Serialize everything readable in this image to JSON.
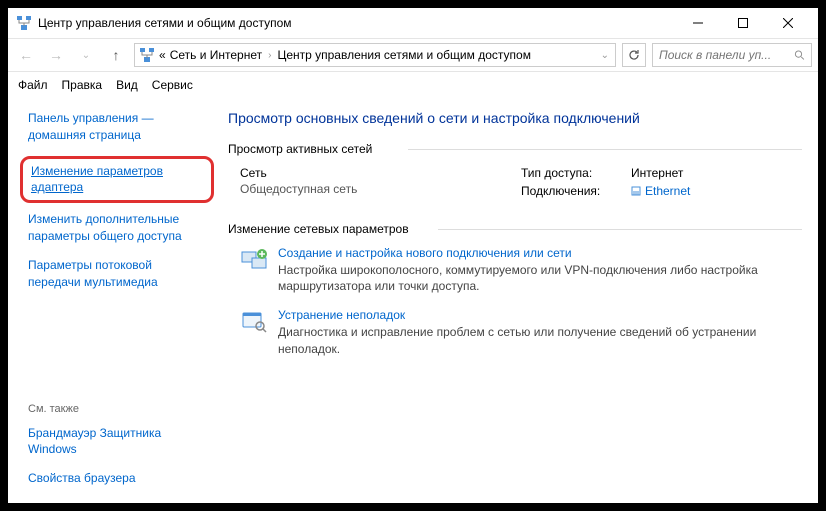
{
  "window": {
    "title": "Центр управления сетями и общим доступом"
  },
  "addressbar": {
    "prefix": "«",
    "seg1": "Сеть и Интернет",
    "seg2": "Центр управления сетями и общим доступом"
  },
  "search": {
    "placeholder": "Поиск в панели уп..."
  },
  "menu": {
    "file": "Файл",
    "edit": "Правка",
    "view": "Вид",
    "tools": "Сервис"
  },
  "sidebar": {
    "home": "Панель управления — домашняя страница",
    "adapter": "Изменение параметров адаптера",
    "sharing": "Изменить дополнительные параметры общего доступа",
    "streaming": "Параметры потоковой передачи мультимедиа",
    "seealso": "См. также",
    "firewall": "Брандмауэр Защитника Windows",
    "browser": "Свойства браузера"
  },
  "main": {
    "heading": "Просмотр основных сведений о сети и настройка подключений",
    "active_label": "Просмотр активных сетей",
    "net_name": "Сеть",
    "net_type": "Общедоступная сеть",
    "access_k": "Тип доступа:",
    "access_v": "Интернет",
    "conn_k": "Подключения:",
    "conn_v": "Ethernet",
    "change_label": "Изменение сетевых параметров",
    "action1_title": "Создание и настройка нового подключения или сети",
    "action1_desc": "Настройка широкополосного, коммутируемого или VPN-подключения либо настройка маршрутизатора или точки доступа.",
    "action2_title": "Устранение неполадок",
    "action2_desc": "Диагностика и исправление проблем с сетью или получение сведений об устранении неполадок."
  }
}
